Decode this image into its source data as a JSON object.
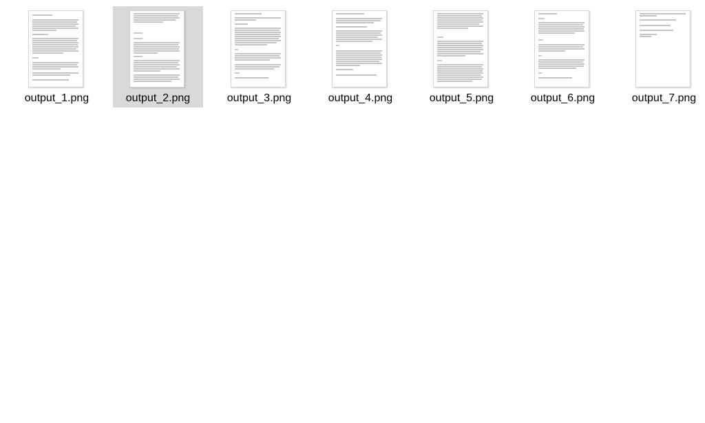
{
  "files": [
    {
      "name": "output_1.png",
      "selected": false
    },
    {
      "name": "output_2.png",
      "selected": true
    },
    {
      "name": "output_3.png",
      "selected": false
    },
    {
      "name": "output_4.png",
      "selected": false
    },
    {
      "name": "output_5.png",
      "selected": false
    },
    {
      "name": "output_6.png",
      "selected": false
    },
    {
      "name": "output_7.png",
      "selected": false
    }
  ],
  "colors": {
    "selection_background": "#d9d9d9",
    "thumbnail_text_lines": "#8a8a8a"
  },
  "icon": "document-thumbnail-icon"
}
